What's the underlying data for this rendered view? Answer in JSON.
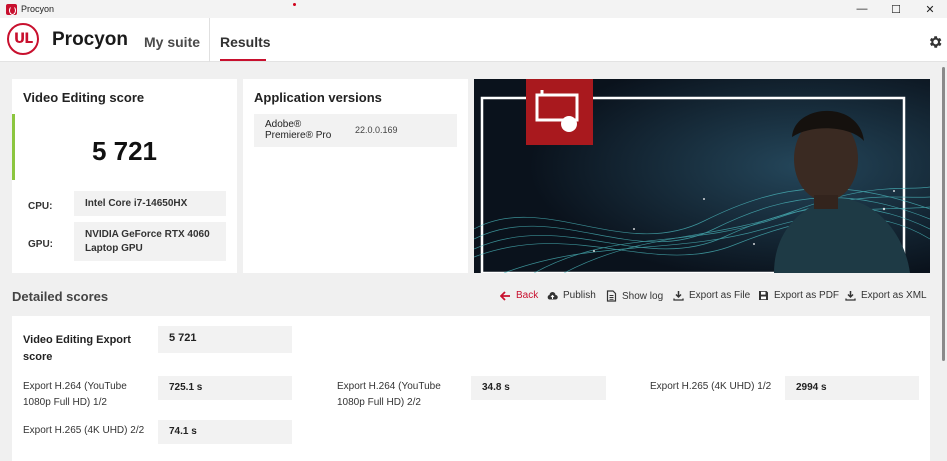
{
  "window": {
    "title": "Procyon",
    "minimize": "—",
    "maximize": "☐",
    "close": "✕"
  },
  "header": {
    "logo": "UL",
    "brand": "Procyon",
    "nav": [
      {
        "label": "My suite"
      },
      {
        "label": "Results"
      }
    ],
    "accent": "#c8102e"
  },
  "score_card": {
    "title": "Video Editing score",
    "score": "5 721",
    "cpu_label": "CPU:",
    "cpu_value": "Intel Core i7-14650HX",
    "gpu_label": "GPU:",
    "gpu_value": "NVIDIA GeForce RTX 4060 Laptop GPU",
    "accent": "#8cc63f"
  },
  "apps_card": {
    "title": "Application versions",
    "apps": [
      {
        "name": "Adobe® Premiere® Pro",
        "version": "22.0.0.169"
      }
    ]
  },
  "details": {
    "title": "Detailed scores",
    "toolbar": [
      {
        "label": "Back",
        "icon": "arrow-left-icon"
      },
      {
        "label": "Publish",
        "icon": "cloud-upload-icon"
      },
      {
        "label": "Show log",
        "icon": "document-icon"
      },
      {
        "label": "Export as File",
        "icon": "download-icon"
      },
      {
        "label": "Export as PDF",
        "icon": "save-icon"
      },
      {
        "label": "Export as XML",
        "icon": "download-icon"
      }
    ],
    "export_score_label": "Video Editing Export score",
    "export_score_value": "5 721",
    "results": [
      {
        "label": "Export H.264 (YouTube 1080p Full HD) 1/2",
        "value": "725.1 s"
      },
      {
        "label": "Export H.264 (YouTube 1080p Full HD) 2/2",
        "value": "34.8 s"
      },
      {
        "label": "Export H.265 (4K UHD) 1/2",
        "value": "2994 s"
      },
      {
        "label": "Export H.265 (4K UHD) 2/2",
        "value": "74.1 s"
      }
    ]
  }
}
